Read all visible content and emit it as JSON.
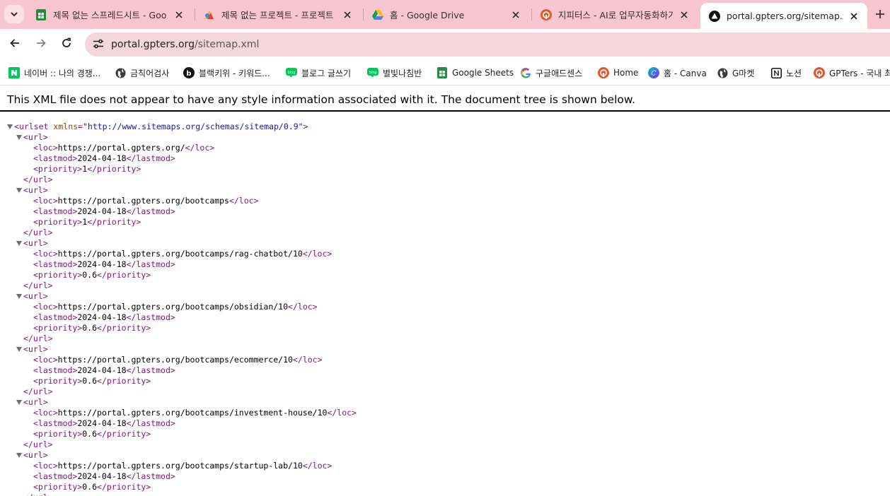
{
  "tabs": [
    {
      "title": "제목 없는 스프레드시트 - Goo",
      "icon": "google-sheets-icon",
      "active": false
    },
    {
      "title": "제목 없는 프로젝트 - 프로젝트",
      "icon": "project-colorful-icon",
      "active": false
    },
    {
      "title": "홈 - Google Drive",
      "icon": "google-drive-icon",
      "active": false
    },
    {
      "title": "지피터스 - AI로 업무자동화하기",
      "icon": "gpters-icon",
      "active": false
    },
    {
      "title": "portal.gpters.org/sitemap.xml",
      "icon": "triangle-logo-icon",
      "active": true
    }
  ],
  "address_bar": {
    "host": "portal.gpters.org",
    "path": "/sitemap.xml"
  },
  "bookmarks": [
    {
      "label": "네이버 :: 나의 경쟁...",
      "icon": "naver-icon"
    },
    {
      "label": "금칙어검사",
      "icon": "globe-icon"
    },
    {
      "label": "블랙키위 - 키워드...",
      "icon": "blackkiwi-icon"
    },
    {
      "label": "블로그 글쓰기",
      "icon": "blog-icon"
    },
    {
      "label": "별빛나침반",
      "icon": "blog-icon"
    },
    {
      "label": "Google Sheets",
      "icon": "google-sheets-icon"
    },
    {
      "label": "구글애드센스",
      "icon": "google-g-icon"
    },
    {
      "label": "Home",
      "icon": "gpters-icon"
    },
    {
      "label": "홈 - Canva",
      "icon": "canva-icon"
    },
    {
      "label": "G마켓",
      "icon": "globe-icon"
    },
    {
      "label": "노션",
      "icon": "notion-icon"
    },
    {
      "label": "GPTers - 국내 최",
      "icon": "gpters-icon"
    }
  ],
  "xml_notice": "This XML file does not appear to have any style information associated with it. The document tree is shown below.",
  "xml": {
    "root_tag": "urlset",
    "root_attr_name": "xmlns",
    "root_attr_value": "\"http://www.sitemaps.org/schemas/sitemap/0.9\"",
    "urls": [
      {
        "loc": "https://portal.gpters.org/",
        "lastmod": "2024-04-18",
        "priority": "1"
      },
      {
        "loc": "https://portal.gpters.org/bootcamps",
        "lastmod": "2024-04-18",
        "priority": "1"
      },
      {
        "loc": "https://portal.gpters.org/bootcamps/rag-chatbot/10",
        "lastmod": "2024-04-18",
        "priority": "0.6"
      },
      {
        "loc": "https://portal.gpters.org/bootcamps/obsidian/10",
        "lastmod": "2024-04-18",
        "priority": "0.6"
      },
      {
        "loc": "https://portal.gpters.org/bootcamps/ecommerce/10",
        "lastmod": "2024-04-18",
        "priority": "0.6"
      },
      {
        "loc": "https://portal.gpters.org/bootcamps/investment-house/10",
        "lastmod": "2024-04-18",
        "priority": "0.6"
      },
      {
        "loc": "https://portal.gpters.org/bootcamps/startup-lab/10",
        "lastmod": "2024-04-18",
        "priority": "0.6"
      }
    ]
  },
  "colors": {
    "tab_strip": "#f7c6d0",
    "omnibox": "#f4d6dd",
    "xml_tag": "#881280",
    "xml_attr_name": "#994500",
    "xml_attr_value": "#1a1aa6"
  }
}
